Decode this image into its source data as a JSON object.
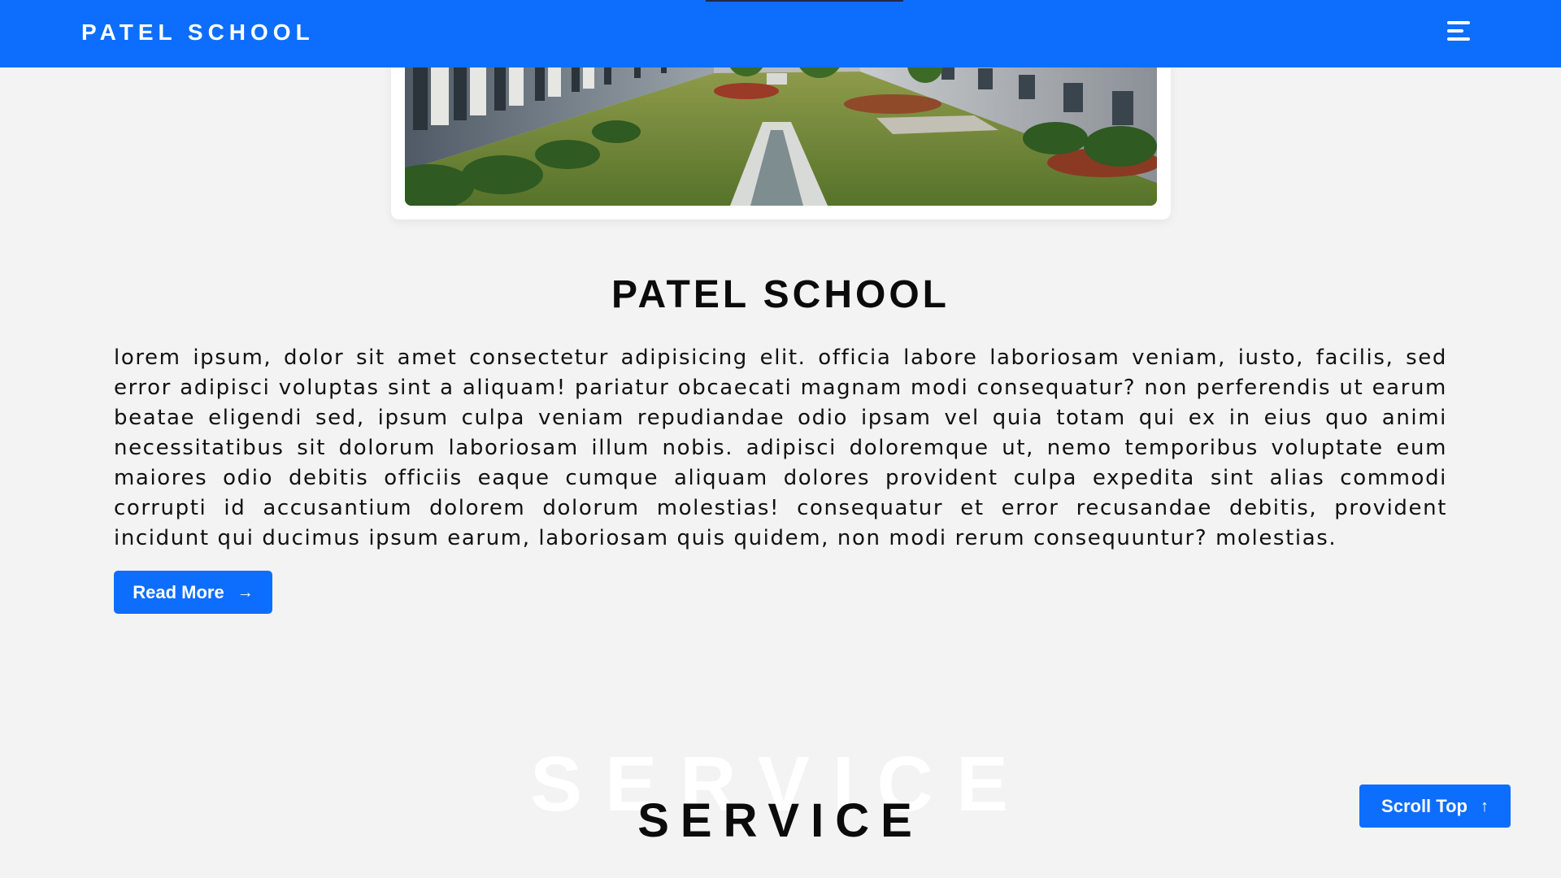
{
  "navbar": {
    "brand": "PATEL SCHOOL",
    "menu_icon": "hamburger-menu-icon",
    "accent_color": "#0d6efd"
  },
  "hero_image": {
    "subject": "school courtyard garden photo"
  },
  "about": {
    "title": "PATEL SCHOOL",
    "text": "lorem ipsum, dolor sit amet consectetur adipisicing elit. officia labore laboriosam veniam, iusto, facilis, sed error adipisci voluptas sint a aliquam! pariatur obcaecati magnam modi consequatur? non perferendis ut earum beatae eligendi sed, ipsum culpa veniam repudiandae odio ipsam vel quia totam qui ex in eius quo animi necessitatibus sit dolorum laboriosam illum nobis. adipisci doloremque ut, nemo temporibus voluptate eum maiores odio debitis officiis eaque cumque aliquam dolores provident culpa expedita sint alias commodi corrupti id accusantium dolorem dolorum molestias! consequatur et error recusandae debitis, provident incidunt qui ducimus ipsum earum, laboriosam quis quidem, non modi rerum consequuntur? molestias.",
    "read_more_label": "Read More",
    "read_more_icon": "arrow-right-icon"
  },
  "service": {
    "background_word": "SERVICE",
    "title": "SERVICE"
  },
  "scroll_top": {
    "label": "Scroll Top",
    "icon": "arrow-up-icon"
  }
}
